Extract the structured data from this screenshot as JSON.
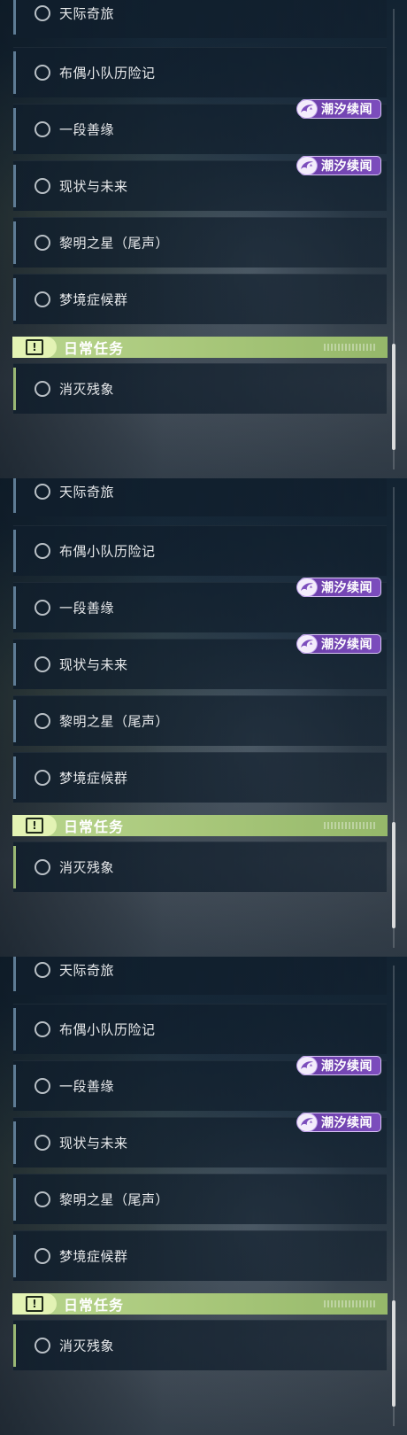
{
  "quests": [
    "天际奇旅",
    "布偶小队历险记",
    "一段善缘",
    "现状与未来",
    "黎明之星（尾声）",
    "梦境症候群"
  ],
  "tag": {
    "label": "潮汐续闻",
    "icon": "tide-swirl-icon",
    "color": "#7c4dbd"
  },
  "daily": {
    "title": "日常任务",
    "icon": "exclamation-box-icon",
    "accent": "#a8c77a",
    "items": [
      "消灭残象"
    ]
  }
}
